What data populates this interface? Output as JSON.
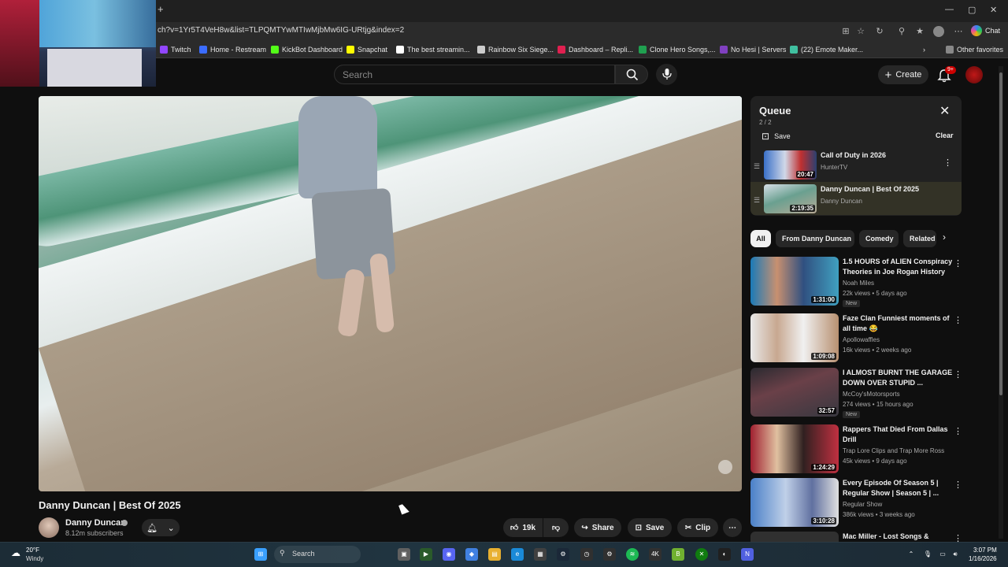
{
  "browser": {
    "url": "ch?v=1Yr5T4VeH8w&list=TLPQMTYwMTIwMjbMw6IG-URtjg&index=2",
    "chat_label": "Chat",
    "bookmarks": [
      {
        "label": "Twitch",
        "color": "#9146ff"
      },
      {
        "label": "Home - Restream",
        "color": "#3b6cff"
      },
      {
        "label": "KickBot Dashboard",
        "color": "#53fc18"
      },
      {
        "label": "Snapchat",
        "color": "#fffc00"
      },
      {
        "label": "The best streamin...",
        "color": "#ffffff"
      },
      {
        "label": "Rainbow Six Siege...",
        "color": "#cccccc"
      },
      {
        "label": "Dashboard – Repli...",
        "color": "#e02050"
      },
      {
        "label": "Clone Hero Songs,...",
        "color": "#20a050"
      },
      {
        "label": "No Hesi | Servers",
        "color": "#8040c0"
      },
      {
        "label": "(22) Emote Maker...",
        "color": "#40c0a0"
      }
    ],
    "other_favorites": "Other favorites"
  },
  "youtube": {
    "search_placeholder": "Search",
    "create_label": "Create",
    "notif_count": "9+",
    "video": {
      "title": "Danny Duncan | Best Of 2025",
      "channel": "Danny Duncan",
      "subscribers": "8.12m subscribers",
      "likes": "19k",
      "share": "Share",
      "save": "Save",
      "clip": "Clip"
    },
    "queue": {
      "title": "Queue",
      "count": "2 / 2",
      "save": "Save",
      "clear": "Clear",
      "items": [
        {
          "title": "Call of Duty in 2026",
          "channel": "HunterTV",
          "duration": "20:47"
        },
        {
          "title": "Danny Duncan | Best Of 2025",
          "channel": "Danny Duncan",
          "duration": "2:19:35"
        }
      ]
    },
    "chips": [
      "All",
      "From Danny Duncan",
      "Comedy",
      "Related"
    ],
    "recommendations": [
      {
        "title": "1.5 HOURS of ALIEN Conspiracy Theories in Joe Rogan History",
        "channel": "Noah Miles",
        "meta": "22k views • 5 days ago",
        "duration": "1:31:00",
        "badge": "New"
      },
      {
        "title": "Faze Clan Funniest moments of all time 😂",
        "channel": "Apollowaffles",
        "meta": "16k views • 2 weeks ago",
        "duration": "1:09:08",
        "badge": ""
      },
      {
        "title": "I ALMOST BURNT THE GARAGE DOWN OVER STUPID ...",
        "channel": "McCoy'sMotorsports",
        "meta": "274 views • 15 hours ago",
        "duration": "32:57",
        "badge": "New"
      },
      {
        "title": "Rappers That Died From Dallas Drill",
        "channel": "Trap Lore Clips and Trap More Ross",
        "meta": "45k views • 9 days ago",
        "duration": "1:24:29",
        "badge": ""
      },
      {
        "title": "Every Episode Of Season 5 | Regular Show | Season 5 | ...",
        "channel": "Regular Show",
        "meta": "386k views • 3 weeks ago",
        "duration": "3:10:28",
        "badge": ""
      },
      {
        "title": "Mac Miller - Lost Songs &",
        "channel": "",
        "meta": "",
        "duration": "",
        "badge": ""
      }
    ]
  },
  "taskbar": {
    "temp": "20°F",
    "condition": "Windy",
    "search": "Search",
    "time": "3:07 PM",
    "date": "1/16/2026"
  }
}
